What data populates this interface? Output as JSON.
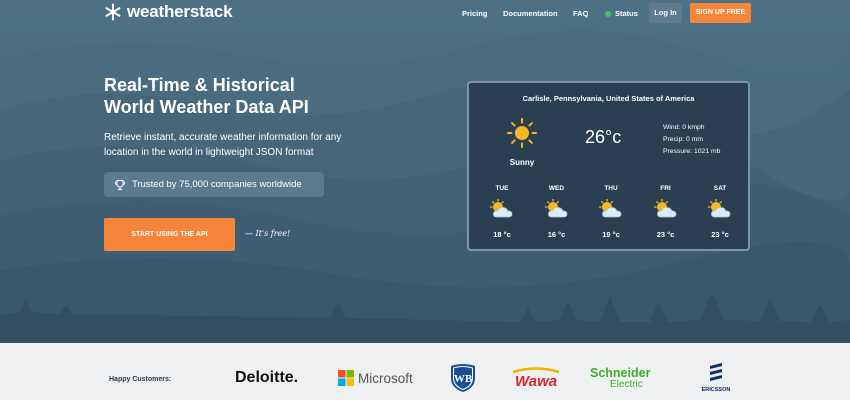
{
  "brand": {
    "name": "weatherstack"
  },
  "nav": {
    "links": [
      "Pricing",
      "Documentation",
      "FAQ"
    ],
    "status": "Status",
    "login": "Log In",
    "signup": "SIGN UP FREE"
  },
  "hero": {
    "title_line1": "Real-Time & Historical",
    "title_line2": "World Weather Data API",
    "subtitle": "Retrieve instant, accurate weather information for any location in the world in lightweight JSON format",
    "trust": "Trusted by 75,000 companies worldwide",
    "cta": "START USING THE API",
    "free_note": "— It's free!"
  },
  "widget": {
    "location": "Carlisle, Pennsylvania, United States of America",
    "condition": "Sunny",
    "temperature": "26°c",
    "wind": "Wind: 0 kmph",
    "precip": "Precip: 0 mm",
    "pressure": "Pressure: 1021 mb",
    "forecast": [
      {
        "day": "TUE",
        "temp": "18 °c",
        "icon": "partly-cloudy-icon"
      },
      {
        "day": "WED",
        "temp": "16 °c",
        "icon": "partly-cloudy-icon"
      },
      {
        "day": "THU",
        "temp": "19 °c",
        "icon": "partly-cloudy-icon"
      },
      {
        "day": "FRI",
        "temp": "23 °c",
        "icon": "partly-cloudy-icon"
      },
      {
        "day": "SAT",
        "temp": "23 °c",
        "icon": "partly-cloudy-icon"
      }
    ]
  },
  "customers": {
    "label": "Happy Customers:",
    "logos": [
      "Deloitte.",
      "Microsoft",
      "WB",
      "Wawa",
      "Schneider",
      "Electric",
      "ERICSSON"
    ]
  },
  "colors": {
    "accent": "#f6853a",
    "status_green": "#3cc45f",
    "widget_bg": "#2a4052",
    "sun": "#f7b722"
  }
}
